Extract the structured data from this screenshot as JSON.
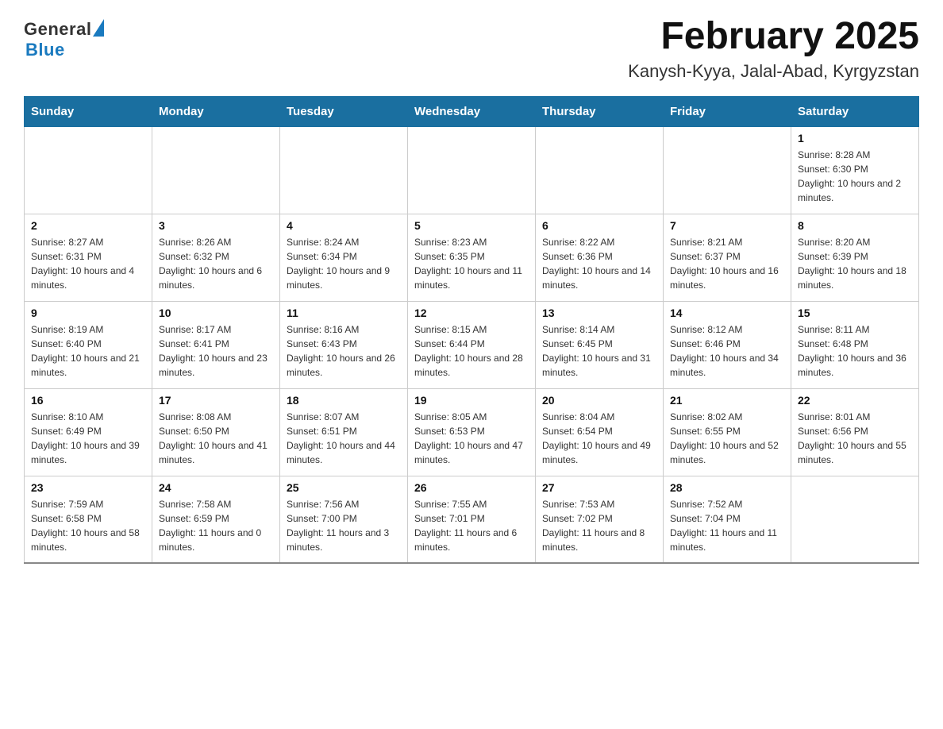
{
  "logo": {
    "general": "General",
    "blue": "Blue"
  },
  "title": "February 2025",
  "subtitle": "Kanysh-Kyya, Jalal-Abad, Kyrgyzstan",
  "days_of_week": [
    "Sunday",
    "Monday",
    "Tuesday",
    "Wednesday",
    "Thursday",
    "Friday",
    "Saturday"
  ],
  "weeks": [
    [
      {
        "day": "",
        "info": ""
      },
      {
        "day": "",
        "info": ""
      },
      {
        "day": "",
        "info": ""
      },
      {
        "day": "",
        "info": ""
      },
      {
        "day": "",
        "info": ""
      },
      {
        "day": "",
        "info": ""
      },
      {
        "day": "1",
        "info": "Sunrise: 8:28 AM\nSunset: 6:30 PM\nDaylight: 10 hours and 2 minutes."
      }
    ],
    [
      {
        "day": "2",
        "info": "Sunrise: 8:27 AM\nSunset: 6:31 PM\nDaylight: 10 hours and 4 minutes."
      },
      {
        "day": "3",
        "info": "Sunrise: 8:26 AM\nSunset: 6:32 PM\nDaylight: 10 hours and 6 minutes."
      },
      {
        "day": "4",
        "info": "Sunrise: 8:24 AM\nSunset: 6:34 PM\nDaylight: 10 hours and 9 minutes."
      },
      {
        "day": "5",
        "info": "Sunrise: 8:23 AM\nSunset: 6:35 PM\nDaylight: 10 hours and 11 minutes."
      },
      {
        "day": "6",
        "info": "Sunrise: 8:22 AM\nSunset: 6:36 PM\nDaylight: 10 hours and 14 minutes."
      },
      {
        "day": "7",
        "info": "Sunrise: 8:21 AM\nSunset: 6:37 PM\nDaylight: 10 hours and 16 minutes."
      },
      {
        "day": "8",
        "info": "Sunrise: 8:20 AM\nSunset: 6:39 PM\nDaylight: 10 hours and 18 minutes."
      }
    ],
    [
      {
        "day": "9",
        "info": "Sunrise: 8:19 AM\nSunset: 6:40 PM\nDaylight: 10 hours and 21 minutes."
      },
      {
        "day": "10",
        "info": "Sunrise: 8:17 AM\nSunset: 6:41 PM\nDaylight: 10 hours and 23 minutes."
      },
      {
        "day": "11",
        "info": "Sunrise: 8:16 AM\nSunset: 6:43 PM\nDaylight: 10 hours and 26 minutes."
      },
      {
        "day": "12",
        "info": "Sunrise: 8:15 AM\nSunset: 6:44 PM\nDaylight: 10 hours and 28 minutes."
      },
      {
        "day": "13",
        "info": "Sunrise: 8:14 AM\nSunset: 6:45 PM\nDaylight: 10 hours and 31 minutes."
      },
      {
        "day": "14",
        "info": "Sunrise: 8:12 AM\nSunset: 6:46 PM\nDaylight: 10 hours and 34 minutes."
      },
      {
        "day": "15",
        "info": "Sunrise: 8:11 AM\nSunset: 6:48 PM\nDaylight: 10 hours and 36 minutes."
      }
    ],
    [
      {
        "day": "16",
        "info": "Sunrise: 8:10 AM\nSunset: 6:49 PM\nDaylight: 10 hours and 39 minutes."
      },
      {
        "day": "17",
        "info": "Sunrise: 8:08 AM\nSunset: 6:50 PM\nDaylight: 10 hours and 41 minutes."
      },
      {
        "day": "18",
        "info": "Sunrise: 8:07 AM\nSunset: 6:51 PM\nDaylight: 10 hours and 44 minutes."
      },
      {
        "day": "19",
        "info": "Sunrise: 8:05 AM\nSunset: 6:53 PM\nDaylight: 10 hours and 47 minutes."
      },
      {
        "day": "20",
        "info": "Sunrise: 8:04 AM\nSunset: 6:54 PM\nDaylight: 10 hours and 49 minutes."
      },
      {
        "day": "21",
        "info": "Sunrise: 8:02 AM\nSunset: 6:55 PM\nDaylight: 10 hours and 52 minutes."
      },
      {
        "day": "22",
        "info": "Sunrise: 8:01 AM\nSunset: 6:56 PM\nDaylight: 10 hours and 55 minutes."
      }
    ],
    [
      {
        "day": "23",
        "info": "Sunrise: 7:59 AM\nSunset: 6:58 PM\nDaylight: 10 hours and 58 minutes."
      },
      {
        "day": "24",
        "info": "Sunrise: 7:58 AM\nSunset: 6:59 PM\nDaylight: 11 hours and 0 minutes."
      },
      {
        "day": "25",
        "info": "Sunrise: 7:56 AM\nSunset: 7:00 PM\nDaylight: 11 hours and 3 minutes."
      },
      {
        "day": "26",
        "info": "Sunrise: 7:55 AM\nSunset: 7:01 PM\nDaylight: 11 hours and 6 minutes."
      },
      {
        "day": "27",
        "info": "Sunrise: 7:53 AM\nSunset: 7:02 PM\nDaylight: 11 hours and 8 minutes."
      },
      {
        "day": "28",
        "info": "Sunrise: 7:52 AM\nSunset: 7:04 PM\nDaylight: 11 hours and 11 minutes."
      },
      {
        "day": "",
        "info": ""
      }
    ]
  ]
}
